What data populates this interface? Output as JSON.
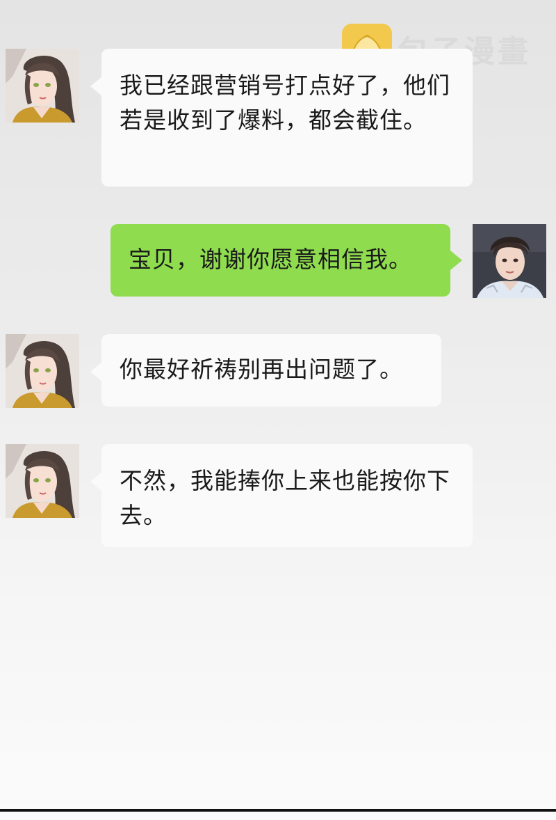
{
  "watermark": {
    "text": "包子漫畫",
    "logo_icon": "steamed-bun-icon",
    "logo_color": "#f2c94c"
  },
  "messages": [
    {
      "sender": "female",
      "direction": "incoming",
      "text": "我已经跟营销号打点好了，他们若是收到了爆料，都会截住。"
    },
    {
      "sender": "male",
      "direction": "outgoing",
      "text": "宝贝，谢谢你愿意相信我。"
    },
    {
      "sender": "female",
      "direction": "incoming",
      "text": "你最好祈祷别再出问题了。"
    },
    {
      "sender": "female",
      "direction": "incoming",
      "text": "不然，我能捧你上来也能按你下去。"
    }
  ],
  "colors": {
    "incoming_bubble": "#fafafa",
    "outgoing_bubble": "#8fdc4f",
    "background": "#e8e8e8"
  }
}
